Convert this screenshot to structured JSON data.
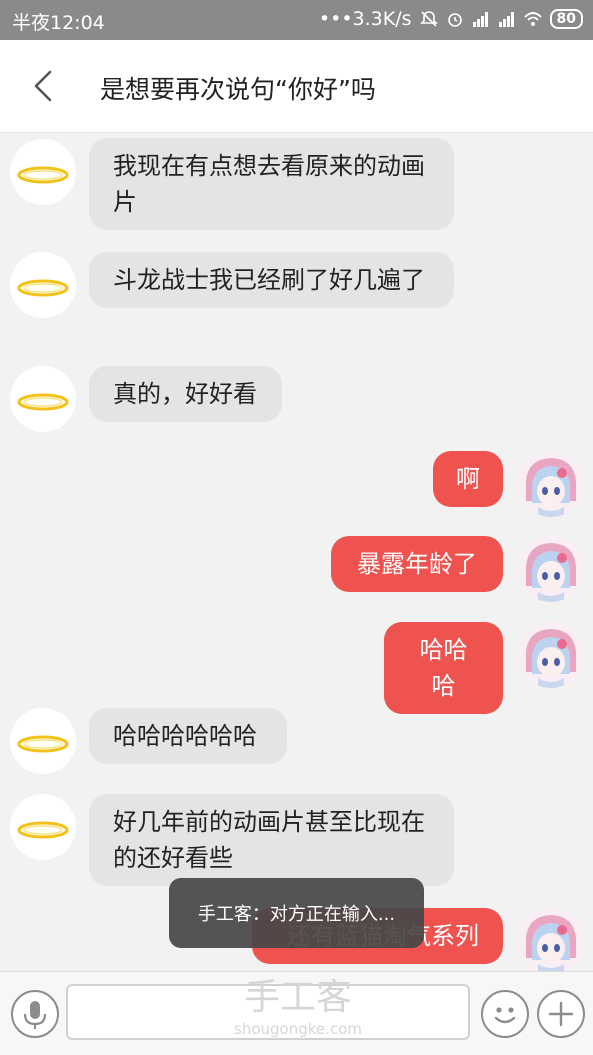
{
  "status_bar": {
    "time": "半夜12:04",
    "speed": "•••3.3K/s",
    "battery": "80"
  },
  "header": {
    "title": "是想要再次说句“你好”吗"
  },
  "messages": [
    {
      "side": "in",
      "text": "我现在有点想去看原来的动画片"
    },
    {
      "side": "in",
      "text": "斗龙战士我已经刷了好几遍了"
    },
    {
      "side": "in",
      "text": "真的，好好看"
    },
    {
      "side": "out",
      "text": "啊"
    },
    {
      "side": "out",
      "text": "暴露年龄了"
    },
    {
      "side": "out",
      "text": "哈哈哈"
    },
    {
      "side": "in",
      "text": "哈哈哈哈哈哈"
    },
    {
      "side": "in",
      "text": "好几年前的动画片甚至比现在的还好看些"
    },
    {
      "side": "out",
      "text": "还有蓝猫淘气系列"
    }
  ],
  "toast": {
    "text": "手工客：对方正在输入..."
  },
  "input_bar": {
    "placeholder": ""
  },
  "watermark": {
    "brand": "手工客",
    "domain": "shougongke.com"
  },
  "icons": {
    "back": "chevron-left-icon",
    "mic": "microphone-icon",
    "emoji": "smiley-icon",
    "plus": "plus-icon",
    "partner_avatar": "halo-ring-icon"
  },
  "colors": {
    "outgoing_bubble": "#ef5350",
    "incoming_bubble": "#e4e4e4",
    "halo": "#f2c21b"
  }
}
